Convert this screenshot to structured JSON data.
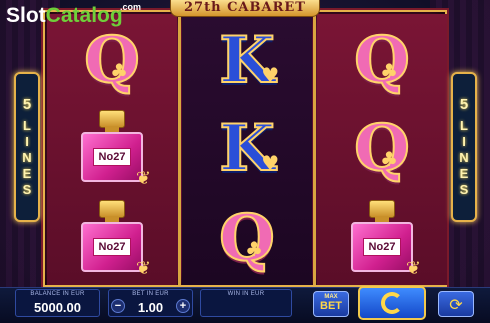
{
  "watermark": {
    "part1": "Slot",
    "part2": "Catalog",
    "suffix": ".com"
  },
  "title": "27th CABARET",
  "lines_board": {
    "number": "5",
    "label": "LINES"
  },
  "reels": [
    [
      {
        "type": "letter",
        "glyph": "Q",
        "suit": "♣"
      },
      {
        "type": "bottle",
        "label": "No27"
      },
      {
        "type": "bottle",
        "label": "No27"
      }
    ],
    [
      {
        "type": "letter",
        "glyph": "K",
        "suit": "♥"
      },
      {
        "type": "letter",
        "glyph": "K",
        "suit": "♥"
      },
      {
        "type": "letter",
        "glyph": "Q",
        "suit": "♣"
      }
    ],
    [
      {
        "type": "letter",
        "glyph": "Q",
        "suit": "♣"
      },
      {
        "type": "letter",
        "glyph": "Q",
        "suit": "♣"
      },
      {
        "type": "bottle",
        "label": "No27"
      }
    ]
  ],
  "bottom": {
    "balance_caption": "BALANCE IN EUR",
    "balance_value": "5000.00",
    "bet_caption": "BET IN EUR",
    "bet_value": "1.00",
    "bet_minus": "−",
    "bet_plus": "+",
    "win_caption": "WIN IN EUR",
    "win_value": "",
    "maxbet_small": "MAX",
    "maxbet_big": "BET"
  },
  "icons": {
    "spin": "spin-icon",
    "autoplay": "autoplay-icon"
  },
  "colors": {
    "reel_bg": "#7a1535",
    "gold": "#e6b24a",
    "spin_blue": "#1448c8"
  }
}
